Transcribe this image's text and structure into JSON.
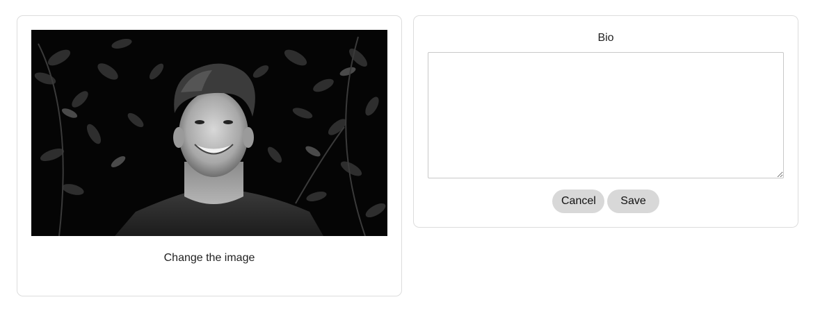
{
  "profile_photo": {
    "alt": "Black and white portrait of a smiling young man in front of dark leaves",
    "change_label": "Change the image"
  },
  "bio": {
    "label": "Bio",
    "value": "",
    "placeholder": ""
  },
  "actions": {
    "cancel_label": "Cancel",
    "save_label": "Save"
  }
}
